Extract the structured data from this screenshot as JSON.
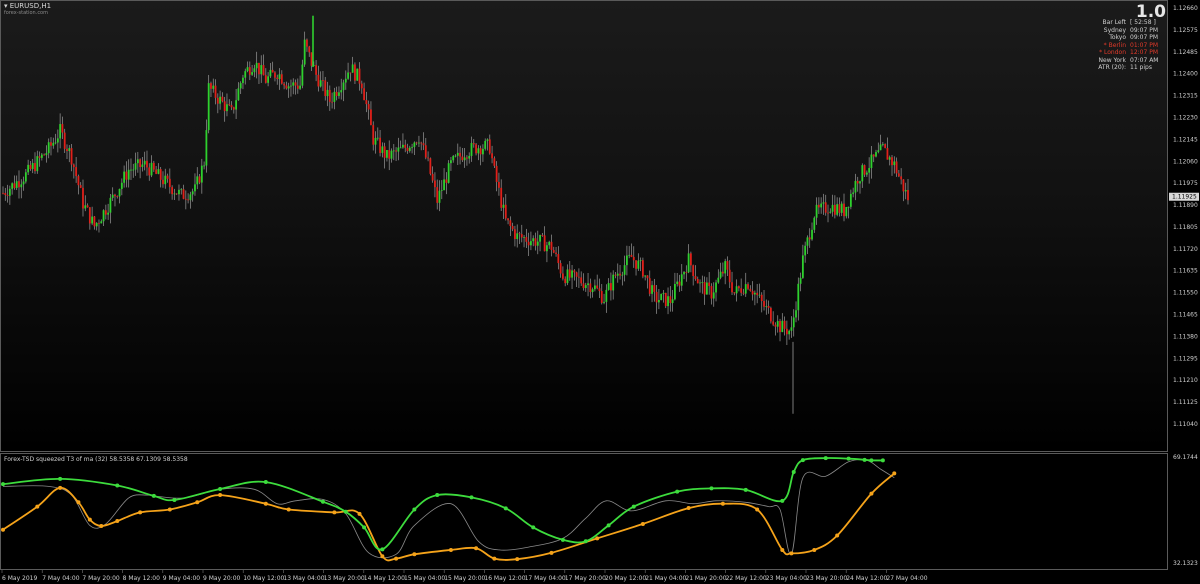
{
  "header": {
    "symbol": "EURUSD,H1",
    "site": "forex-station.com"
  },
  "info_panel": {
    "big_value": "1.0",
    "rows": [
      {
        "label": "Bar Left",
        "value": "[ 52:58 ]",
        "color": "#d0d0d0"
      },
      {
        "label": "Sydney",
        "value": "09:07 PM",
        "color": "#d0d0d0"
      },
      {
        "label": "Tokyo",
        "value": "09:07 PM",
        "color": "#d0d0d0"
      },
      {
        "label": "* Berlin",
        "value": "01:07 PM",
        "color": "#e23a2a"
      },
      {
        "label": "* London",
        "value": "12:07 PM",
        "color": "#e23a2a"
      },
      {
        "label": "New York",
        "value": "07:07 AM",
        "color": "#d0d0d0"
      },
      {
        "label": "ATR (20):",
        "value": "11 pips",
        "color": "#d0d0d0"
      }
    ]
  },
  "colors": {
    "bull": "#2ed12e",
    "bear": "#e0201a",
    "wick": "#9a9a9a",
    "indicator_green": "#3ddc3d",
    "indicator_orange": "#f5a31a",
    "indicator_gray": "#8a8a8a",
    "price_tag": "#d8d8d8"
  },
  "chart_data": [
    {
      "type": "candlestick",
      "title": "EURUSD,H1",
      "y_ticks": [
        "1.12660",
        "1.12575",
        "1.12485",
        "1.12400",
        "1.12315",
        "1.12230",
        "1.12145",
        "1.12060",
        "1.11975",
        "1.11890",
        "1.11805",
        "1.11720",
        "1.11635",
        "1.11550",
        "1.11465",
        "1.11380",
        "1.11295",
        "1.11210",
        "1.11125",
        "1.11040"
      ],
      "ylim": [
        1.1104,
        1.1266
      ],
      "current_price": "1.11925",
      "x_ticks": [
        "6 May 2019",
        "7 May 04:00",
        "7 May 20:00",
        "8 May 12:00",
        "9 May 04:00",
        "9 May 20:00",
        "10 May 12:00",
        "13 May 04:00",
        "13 May 20:00",
        "14 May 12:00",
        "15 May 04:00",
        "15 May 20:00",
        "16 May 12:00",
        "17 May 04:00",
        "17 May 20:00",
        "20 May 12:00",
        "21 May 04:00",
        "21 May 20:00",
        "22 May 12:00",
        "23 May 04:00",
        "23 May 20:00",
        "24 May 12:00",
        "27 May 04:00"
      ],
      "close_path": [
        [
          0,
          1.1194
        ],
        [
          10,
          1.1201
        ],
        [
          20,
          1.1211
        ],
        [
          25,
          1.1218
        ],
        [
          30,
          1.1208
        ],
        [
          35,
          1.119
        ],
        [
          40,
          1.1181
        ],
        [
          48,
          1.1192
        ],
        [
          55,
          1.1203
        ],
        [
          62,
          1.1205
        ],
        [
          70,
          1.1199
        ],
        [
          78,
          1.1193
        ],
        [
          84,
          1.1195
        ],
        [
          88,
          1.1206
        ],
        [
          90,
          1.1235
        ],
        [
          95,
          1.123
        ],
        [
          100,
          1.1225
        ],
        [
          105,
          1.124
        ],
        [
          110,
          1.1245
        ],
        [
          115,
          1.1238
        ],
        [
          120,
          1.1241
        ],
        [
          125,
          1.1236
        ],
        [
          130,
          1.1236
        ],
        [
          132,
          1.1252
        ],
        [
          137,
          1.124
        ],
        [
          143,
          1.123
        ],
        [
          148,
          1.1237
        ],
        [
          152,
          1.1243
        ],
        [
          157,
          1.1237
        ],
        [
          162,
          1.1215
        ],
        [
          168,
          1.1208
        ],
        [
          175,
          1.1211
        ],
        [
          182,
          1.1216
        ],
        [
          186,
          1.1205
        ],
        [
          190,
          1.1191
        ],
        [
          196,
          1.1205
        ],
        [
          202,
          1.121
        ],
        [
          208,
          1.1212
        ],
        [
          213,
          1.1212
        ],
        [
          215,
          1.1202
        ],
        [
          220,
          1.1183
        ],
        [
          225,
          1.1177
        ],
        [
          230,
          1.1176
        ],
        [
          235,
          1.1175
        ],
        [
          240,
          1.1173
        ],
        [
          245,
          1.1162
        ],
        [
          252,
          1.116
        ],
        [
          258,
          1.1158
        ],
        [
          263,
          1.1153
        ],
        [
          268,
          1.1162
        ],
        [
          275,
          1.1169
        ],
        [
          280,
          1.1164
        ],
        [
          285,
          1.1153
        ],
        [
          292,
          1.1152
        ],
        [
          300,
          1.1168
        ],
        [
          305,
          1.1158
        ],
        [
          310,
          1.1155
        ],
        [
          316,
          1.1165
        ],
        [
          320,
          1.1155
        ],
        [
          326,
          1.1159
        ],
        [
          332,
          1.1151
        ],
        [
          340,
          1.1142
        ],
        [
          345,
          1.114
        ],
        [
          350,
          1.1168
        ],
        [
          355,
          1.1186
        ],
        [
          362,
          1.1189
        ],
        [
          368,
          1.1187
        ],
        [
          374,
          1.12
        ],
        [
          380,
          1.1206
        ],
        [
          385,
          1.1211
        ],
        [
          390,
          1.1205
        ],
        [
          394,
          1.1196
        ],
        [
          396,
          1.1192
        ]
      ]
    },
    {
      "type": "line",
      "title": "Forex-TSD squeezed T3 of ma (32) 58.5358 67.1309 58.5358",
      "y_ticks": [
        "69.1744",
        "32.1323"
      ],
      "ylim": [
        32.1323,
        69.1744
      ],
      "series": [
        {
          "color": "green",
          "points": [
            [
              0,
              59.8
            ],
            [
              25,
              61.6
            ],
            [
              50,
              59.3
            ],
            [
              66,
              55.7
            ],
            [
              75,
              54.3
            ],
            [
              95,
              58.1
            ],
            [
              115,
              60.5
            ],
            [
              140,
              53.7
            ],
            [
              150,
              50.2
            ],
            [
              158,
              44.8
            ],
            [
              166,
              37.2
            ],
            [
              180,
              51.0
            ],
            [
              190,
              56.0
            ],
            [
              205,
              55.2
            ],
            [
              220,
              51.4
            ],
            [
              232,
              44.8
            ],
            [
              245,
              40.5
            ],
            [
              255,
              40.0
            ],
            [
              265,
              45.5
            ],
            [
              276,
              52.0
            ],
            [
              295,
              57.2
            ],
            [
              310,
              58.3
            ],
            [
              325,
              57.8
            ],
            [
              341,
              54.0
            ],
            [
              346,
              64.0
            ],
            [
              350,
              68.1
            ],
            [
              360,
              68.8
            ],
            [
              370,
              68.6
            ],
            [
              377,
              68.2
            ],
            [
              380,
              68.0
            ],
            [
              385,
              68.0
            ]
          ]
        },
        {
          "color": "orange",
          "points": [
            [
              0,
              44.0
            ],
            [
              15,
              52.0
            ],
            [
              25,
              58.5
            ],
            [
              33,
              53.5
            ],
            [
              38,
              47.5
            ],
            [
              43,
              45.3
            ],
            [
              50,
              47.0
            ],
            [
              60,
              50.0
            ],
            [
              73,
              51.0
            ],
            [
              85,
              53.5
            ],
            [
              95,
              56.0
            ],
            [
              115,
              53.0
            ],
            [
              125,
              51.0
            ],
            [
              145,
              50.0
            ],
            [
              156,
              49.5
            ],
            [
              166,
              34.8
            ],
            [
              172,
              34.0
            ],
            [
              180,
              35.5
            ],
            [
              196,
              37.0
            ],
            [
              207,
              37.6
            ],
            [
              215,
              34.0
            ],
            [
              225,
              33.8
            ],
            [
              240,
              36.0
            ],
            [
              260,
              41.0
            ],
            [
              280,
              46.0
            ],
            [
              300,
              51.5
            ],
            [
              315,
              53.0
            ],
            [
              330,
              51.0
            ],
            [
              341,
              37.0
            ],
            [
              345,
              35.8
            ],
            [
              355,
              37.0
            ],
            [
              365,
              42.0
            ],
            [
              380,
              56.5
            ],
            [
              390,
              63.5
            ]
          ]
        },
        {
          "color": "gray",
          "points": [
            [
              0,
              59.0
            ],
            [
              20,
              59.0
            ],
            [
              30,
              56.0
            ],
            [
              38,
              45.5
            ],
            [
              45,
              46.0
            ],
            [
              55,
              55.0
            ],
            [
              63,
              56.0
            ],
            [
              68,
              55.5
            ],
            [
              80,
              55.0
            ],
            [
              95,
              58.0
            ],
            [
              110,
              58.0
            ],
            [
              120,
              53.0
            ],
            [
              128,
              54.0
            ],
            [
              140,
              54.5
            ],
            [
              150,
              49.5
            ],
            [
              160,
              36.0
            ],
            [
              172,
              35.5
            ],
            [
              180,
              45.5
            ],
            [
              196,
              53.0
            ],
            [
              208,
              40.0
            ],
            [
              217,
              37.0
            ],
            [
              230,
              38.0
            ],
            [
              245,
              41.0
            ],
            [
              255,
              48.0
            ],
            [
              264,
              54.0
            ],
            [
              275,
              50.5
            ],
            [
              290,
              54.0
            ],
            [
              302,
              53.0
            ],
            [
              312,
              54.0
            ],
            [
              325,
              53.5
            ],
            [
              335,
              52.0
            ],
            [
              340,
              51.0
            ],
            [
              345,
              35.5
            ],
            [
              350,
              62.0
            ],
            [
              360,
              62.5
            ],
            [
              370,
              67.5
            ],
            [
              378,
              68.0
            ],
            [
              384,
              65.0
            ],
            [
              390,
              62.0
            ]
          ]
        }
      ]
    }
  ]
}
